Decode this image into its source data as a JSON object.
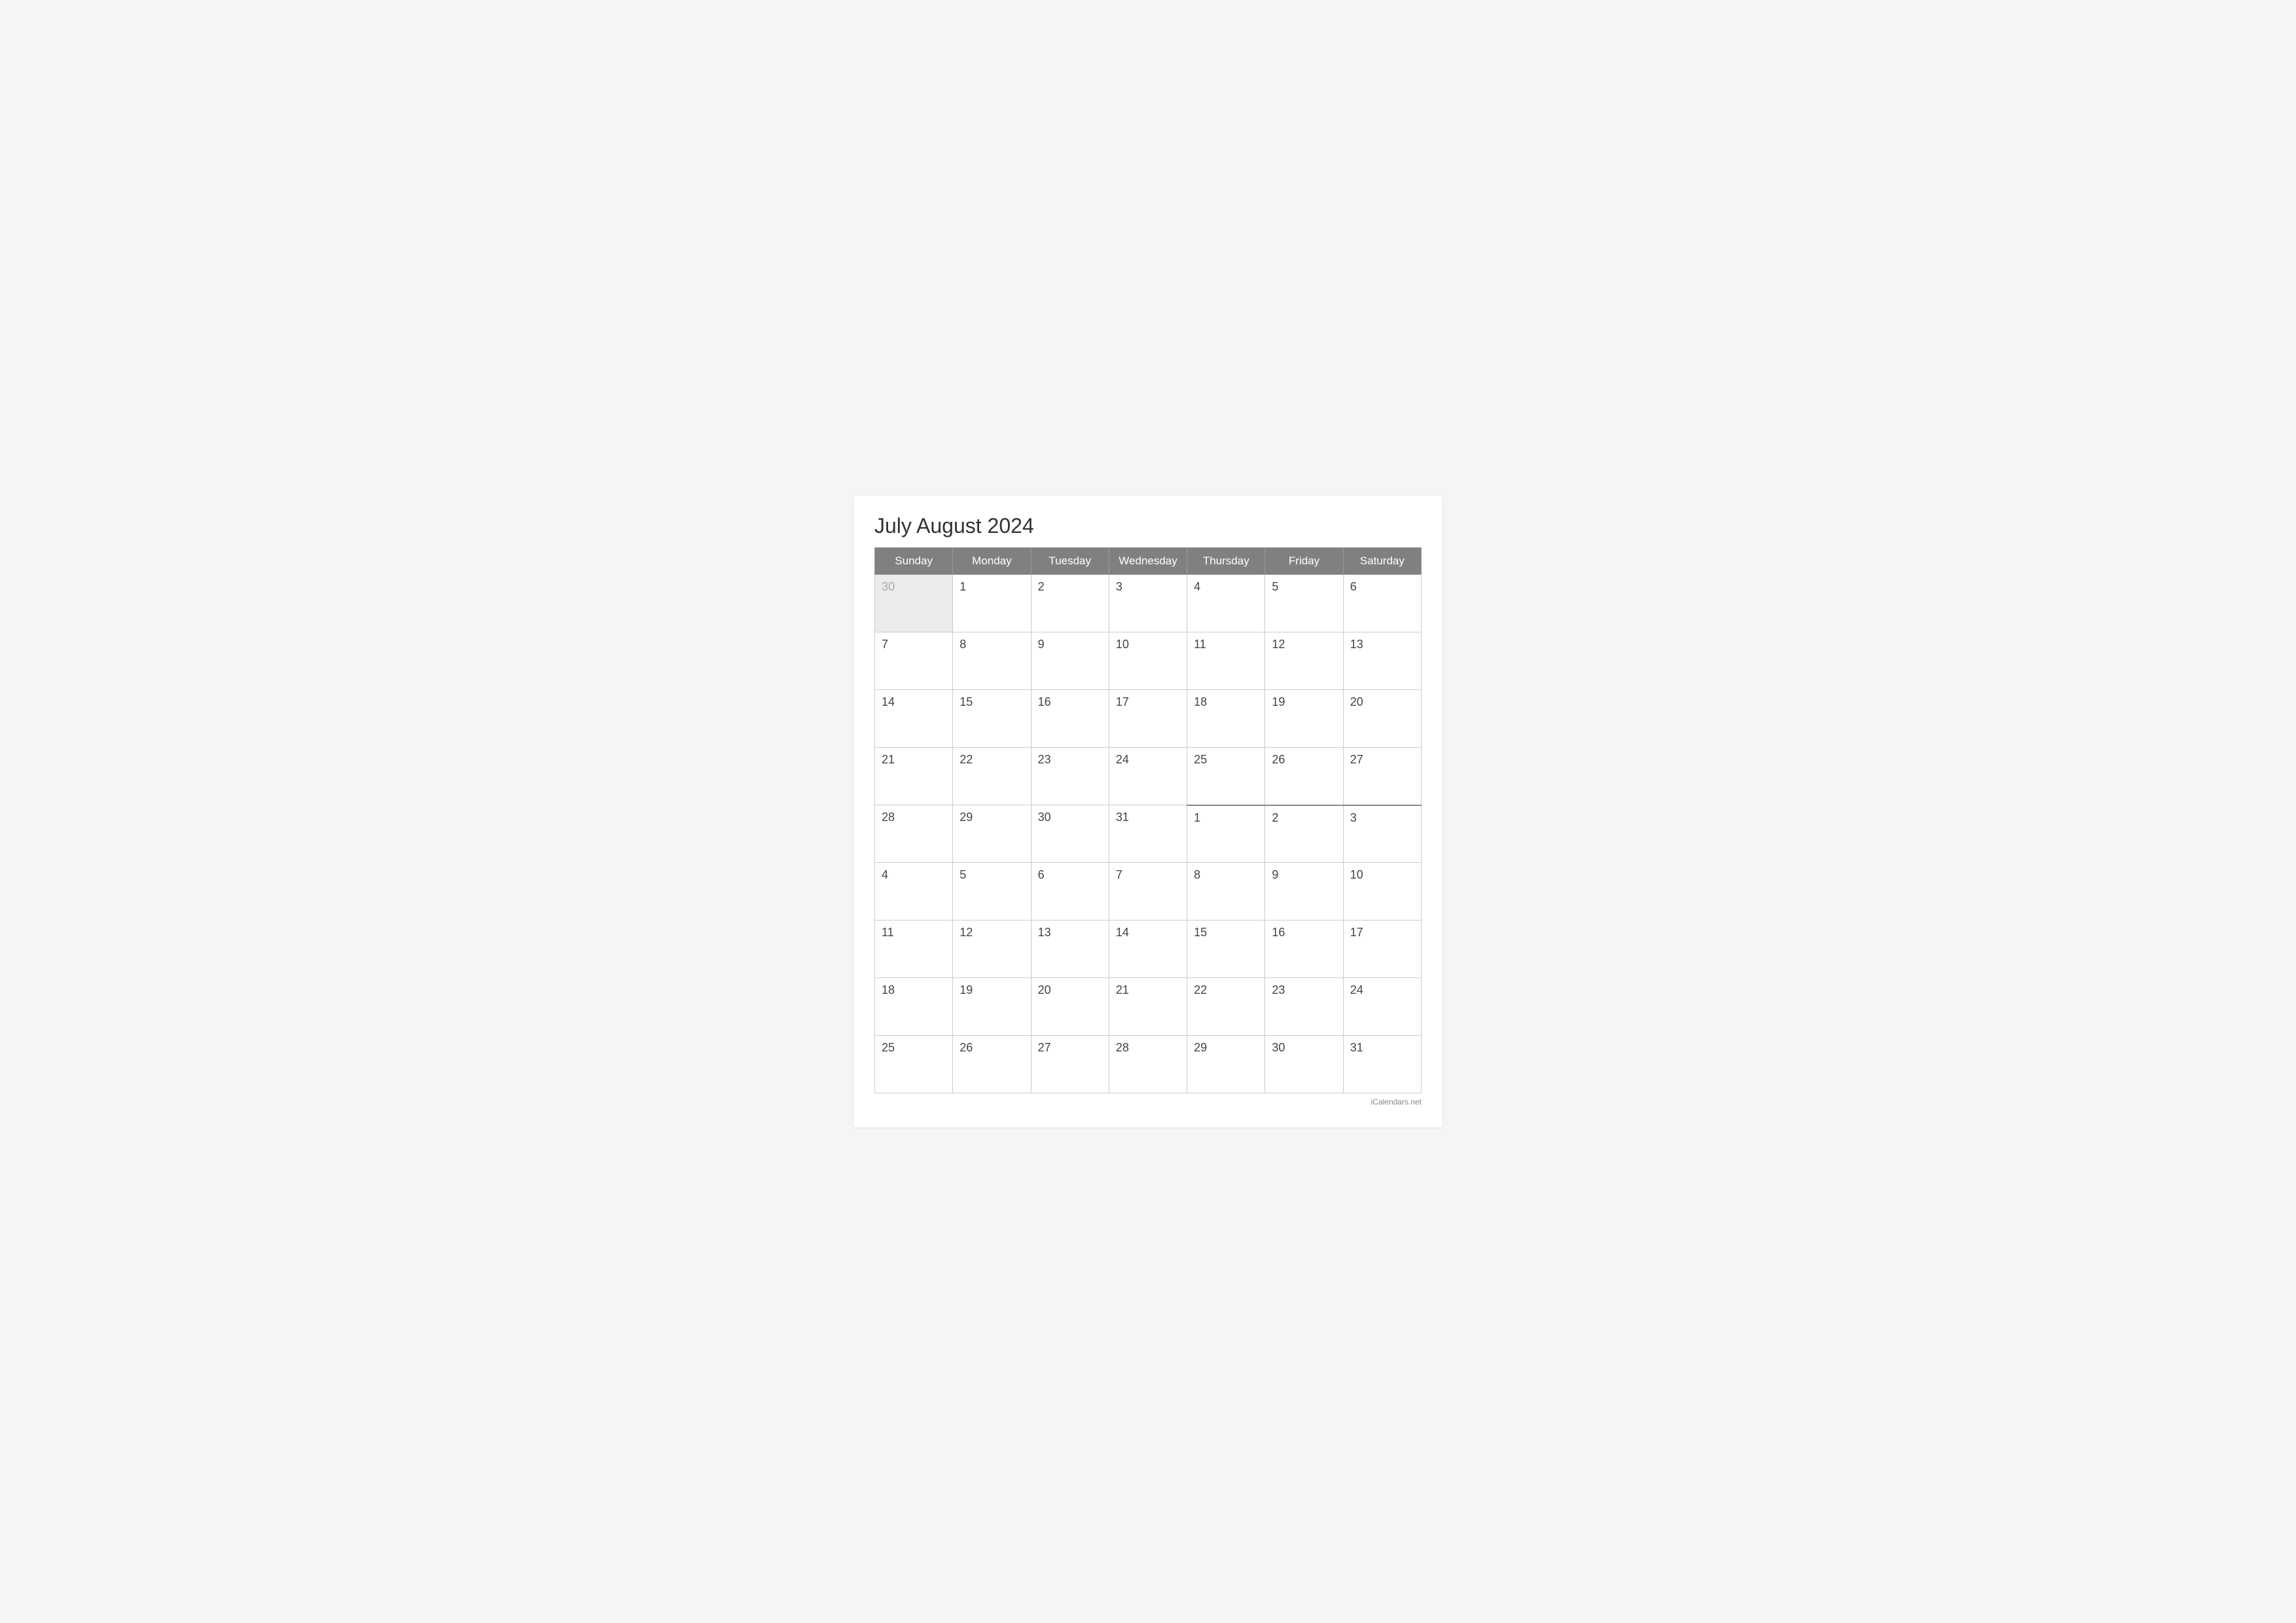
{
  "title": "July August 2024",
  "header": {
    "days": [
      "Sunday",
      "Monday",
      "Tuesday",
      "Wednesday",
      "Thursday",
      "Friday",
      "Saturday"
    ]
  },
  "weeks": [
    {
      "transition": false,
      "cells": [
        {
          "day": "30",
          "type": "prev-month"
        },
        {
          "day": "1",
          "type": "current-month"
        },
        {
          "day": "2",
          "type": "current-month"
        },
        {
          "day": "3",
          "type": "current-month"
        },
        {
          "day": "4",
          "type": "current-month"
        },
        {
          "day": "5",
          "type": "current-month"
        },
        {
          "day": "6",
          "type": "current-month"
        }
      ]
    },
    {
      "transition": false,
      "cells": [
        {
          "day": "7",
          "type": "current-month"
        },
        {
          "day": "8",
          "type": "current-month"
        },
        {
          "day": "9",
          "type": "current-month"
        },
        {
          "day": "10",
          "type": "current-month"
        },
        {
          "day": "11",
          "type": "current-month"
        },
        {
          "day": "12",
          "type": "current-month"
        },
        {
          "day": "13",
          "type": "current-month"
        }
      ]
    },
    {
      "transition": false,
      "cells": [
        {
          "day": "14",
          "type": "current-month"
        },
        {
          "day": "15",
          "type": "current-month"
        },
        {
          "day": "16",
          "type": "current-month"
        },
        {
          "day": "17",
          "type": "current-month"
        },
        {
          "day": "18",
          "type": "current-month"
        },
        {
          "day": "19",
          "type": "current-month"
        },
        {
          "day": "20",
          "type": "current-month"
        }
      ]
    },
    {
      "transition": false,
      "cells": [
        {
          "day": "21",
          "type": "current-month"
        },
        {
          "day": "22",
          "type": "current-month"
        },
        {
          "day": "23",
          "type": "current-month"
        },
        {
          "day": "24",
          "type": "current-month"
        },
        {
          "day": "25",
          "type": "current-month"
        },
        {
          "day": "26",
          "type": "current-month"
        },
        {
          "day": "27",
          "type": "current-month"
        }
      ]
    },
    {
      "transition": true,
      "cells": [
        {
          "day": "28",
          "type": "current-month",
          "august": false
        },
        {
          "day": "29",
          "type": "current-month",
          "august": false
        },
        {
          "day": "30",
          "type": "current-month",
          "august": false
        },
        {
          "day": "31",
          "type": "current-month",
          "august": false
        },
        {
          "day": "1",
          "type": "next-month",
          "august": true
        },
        {
          "day": "2",
          "type": "next-month",
          "august": true
        },
        {
          "day": "3",
          "type": "next-month",
          "august": true
        }
      ]
    },
    {
      "transition": false,
      "cells": [
        {
          "day": "4",
          "type": "current-month"
        },
        {
          "day": "5",
          "type": "current-month"
        },
        {
          "day": "6",
          "type": "current-month"
        },
        {
          "day": "7",
          "type": "current-month"
        },
        {
          "day": "8",
          "type": "current-month"
        },
        {
          "day": "9",
          "type": "current-month"
        },
        {
          "day": "10",
          "type": "current-month"
        }
      ]
    },
    {
      "transition": false,
      "cells": [
        {
          "day": "11",
          "type": "current-month"
        },
        {
          "day": "12",
          "type": "current-month"
        },
        {
          "day": "13",
          "type": "current-month"
        },
        {
          "day": "14",
          "type": "current-month"
        },
        {
          "day": "15",
          "type": "current-month"
        },
        {
          "day": "16",
          "type": "current-month"
        },
        {
          "day": "17",
          "type": "current-month"
        }
      ]
    },
    {
      "transition": false,
      "cells": [
        {
          "day": "18",
          "type": "current-month"
        },
        {
          "day": "19",
          "type": "current-month"
        },
        {
          "day": "20",
          "type": "current-month"
        },
        {
          "day": "21",
          "type": "current-month"
        },
        {
          "day": "22",
          "type": "current-month"
        },
        {
          "day": "23",
          "type": "current-month"
        },
        {
          "day": "24",
          "type": "current-month"
        }
      ]
    },
    {
      "transition": false,
      "cells": [
        {
          "day": "25",
          "type": "current-month"
        },
        {
          "day": "26",
          "type": "current-month"
        },
        {
          "day": "27",
          "type": "current-month"
        },
        {
          "day": "28",
          "type": "current-month"
        },
        {
          "day": "29",
          "type": "current-month"
        },
        {
          "day": "30",
          "type": "current-month"
        },
        {
          "day": "31",
          "type": "current-month"
        }
      ]
    }
  ],
  "footer": {
    "text": "iCalendars.net"
  }
}
